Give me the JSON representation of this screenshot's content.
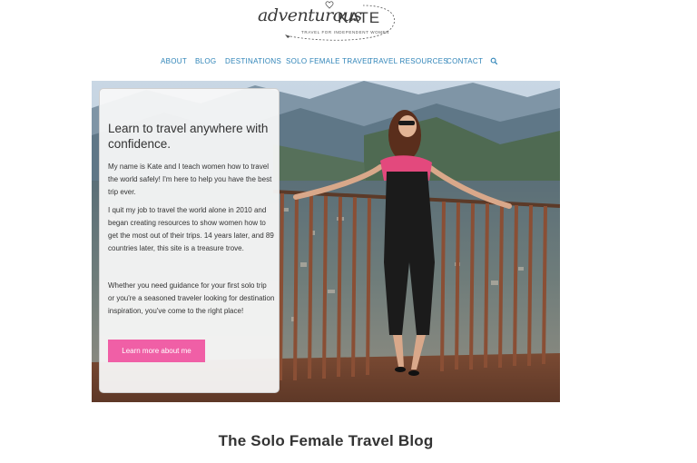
{
  "logo": {
    "script_text": "adventurous",
    "name_text": "KATE",
    "tagline": "TRAVEL FOR INDEPENDENT WOMEN"
  },
  "nav": {
    "items": [
      "ABOUT",
      "BLOG",
      "DESTINATIONS",
      "SOLO FEMALE TRAVEL",
      "TRAVEL RESOURCES",
      "CONTACT"
    ],
    "search_icon": "search-icon"
  },
  "hero": {
    "title": "Learn to travel anywhere with confidence.",
    "paragraphs": [
      "My name is Kate and I teach women how to travel the world safely! I'm here to help you have the best trip ever.",
      "I quit my job to travel the world alone in 2010 and began creating resources to show women how to get the most out of their trips. 14 years later, and 89 countries later, this site is a treasure trove.",
      "Whether you need guidance for your first solo trip or you're a seasoned traveler looking for destination inspiration, you've come to the right place!"
    ],
    "button_label": "Learn more about me"
  },
  "section": {
    "title": "The Solo Female Travel Blog"
  },
  "colors": {
    "nav_link": "#2f84b8",
    "button_bg": "#f05fa6",
    "text": "#333333"
  }
}
